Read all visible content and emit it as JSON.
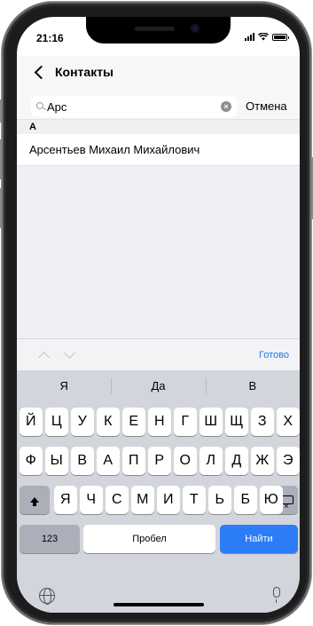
{
  "status_bar": {
    "time": "21:16"
  },
  "nav": {
    "title": "Контакты"
  },
  "search": {
    "value": "Арс",
    "placeholder": "",
    "cancel_label": "Отмена"
  },
  "list": {
    "section_header": "А",
    "contacts": [
      "Арсентьев Михаил Михайлович"
    ]
  },
  "accessory": {
    "done_label": "Готово"
  },
  "keyboard": {
    "suggestions": [
      "Я",
      "Да",
      "В"
    ],
    "row1": [
      "Й",
      "Ц",
      "У",
      "К",
      "Е",
      "Н",
      "Г",
      "Ш",
      "Щ",
      "З",
      "Х"
    ],
    "row2": [
      "Ф",
      "Ы",
      "В",
      "А",
      "П",
      "Р",
      "О",
      "Л",
      "Д",
      "Ж",
      "Э"
    ],
    "row3": [
      "Я",
      "Ч",
      "С",
      "М",
      "И",
      "Т",
      "Ь",
      "Б",
      "Ю"
    ],
    "numbers_label": "123",
    "space_label": "Пробел",
    "go_label": "Найти",
    "accent_color": "#2b7cf6"
  },
  "icons": [
    "back-chevron-icon",
    "search-icon",
    "clear-icon",
    "shift-icon",
    "backspace-icon",
    "globe-icon",
    "mic-icon"
  ]
}
